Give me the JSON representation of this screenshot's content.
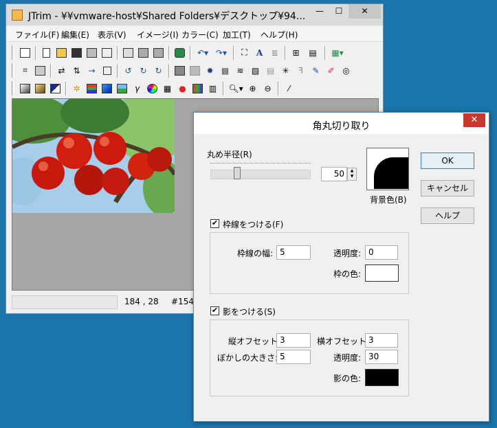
{
  "main_window": {
    "title": "JTrim - ¥¥vmware-host¥Shared Folders¥デスクトップ¥94...",
    "menu": [
      "ファイル(F)",
      "編集(E)",
      "表示(V)",
      "イメージ(I)",
      "カラー(C)",
      "加工(T)",
      "ヘルプ(H)"
    ],
    "status": {
      "coords": "184 , 28",
      "color": "#154"
    }
  },
  "toolbar_icons": {
    "row1": [
      "capture-icon",
      "new-icon",
      "open-icon",
      "save-icon",
      "print-icon",
      "print-preview-icon",
      "copy-icon",
      "paste-icon",
      "paste-new-icon",
      "import-icon",
      "undo-icon",
      "redo-icon",
      "fit-icon",
      "text-icon",
      "align-icon",
      "tile-icon",
      "strip-icon",
      "grid-icon"
    ],
    "row2": [
      "crop-icon",
      "resize-icon",
      "flip-h-icon",
      "flip-v-icon",
      "move-icon",
      "frame-icon",
      "rotate-left-icon",
      "rotate-right-icon",
      "rotate-icon",
      "emboss-icon",
      "relief-icon",
      "burst-icon",
      "mosaic-icon",
      "wave-icon",
      "pattern-icon",
      "brick-icon",
      "spark-icon",
      "ff-icon",
      "pen-icon",
      "brush-icon",
      "spiral-icon"
    ],
    "row3": [
      "gradient-icon",
      "sepia-icon",
      "tone-icon",
      "highlight-icon",
      "rgb-icon",
      "blue-icon",
      "landscape-icon",
      "gamma-icon",
      "color-wheel-icon",
      "checker-icon",
      "rgb-dots-icon",
      "xor-icon",
      "stripes-icon",
      "zoom-icon",
      "zoom-in-icon",
      "zoom-out-icon",
      "eyedropper-icon"
    ]
  },
  "dialog": {
    "title": "角丸切り取り",
    "close_glyph": "✕",
    "radius_label": "丸め半径(R)",
    "radius_value": "50",
    "background_color_label": "背景色(B)",
    "ok_label": "OK",
    "cancel_label": "キャンセル",
    "help_label": "ヘルプ",
    "border": {
      "checkbox_label": "枠線をつける(F)",
      "checked": true,
      "width_label": "枠線の幅:",
      "width_value": "5",
      "opacity_label": "透明度:",
      "opacity_value": "0",
      "color_label": "枠の色:",
      "color": "#ffffff"
    },
    "shadow": {
      "checkbox_label": "影をつける(S)",
      "checked": true,
      "v_offset_label": "縦オフセット:",
      "v_offset_value": "3",
      "h_offset_label": "横オフセット:",
      "h_offset_value": "3",
      "blur_label": "ぼかしの大きさ:",
      "blur_value": "5",
      "opacity_label": "透明度:",
      "opacity_value": "30",
      "color_label": "影の色:",
      "color": "#000000"
    },
    "check_glyph": "✔"
  },
  "colors": {
    "desktop": "#1b74aa",
    "dialog_close": "#c7392f"
  }
}
